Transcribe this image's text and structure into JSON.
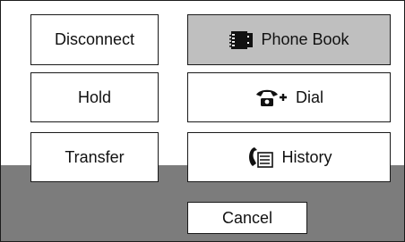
{
  "menu": {
    "disconnect": "Disconnect",
    "hold": "Hold",
    "transfer": "Transfer",
    "phonebook": {
      "label": "Phone Book",
      "icon": "phonebook-icon"
    },
    "dial": {
      "label": "Dial",
      "icon": "phone-plus-icon"
    },
    "history": {
      "label": "History",
      "icon": "phone-list-icon"
    }
  },
  "footer": {
    "cancel": "Cancel"
  },
  "colors": {
    "selected_background": "#bfbfbf",
    "footer_background": "#7c7c7c",
    "border": "#1a1a1a"
  }
}
